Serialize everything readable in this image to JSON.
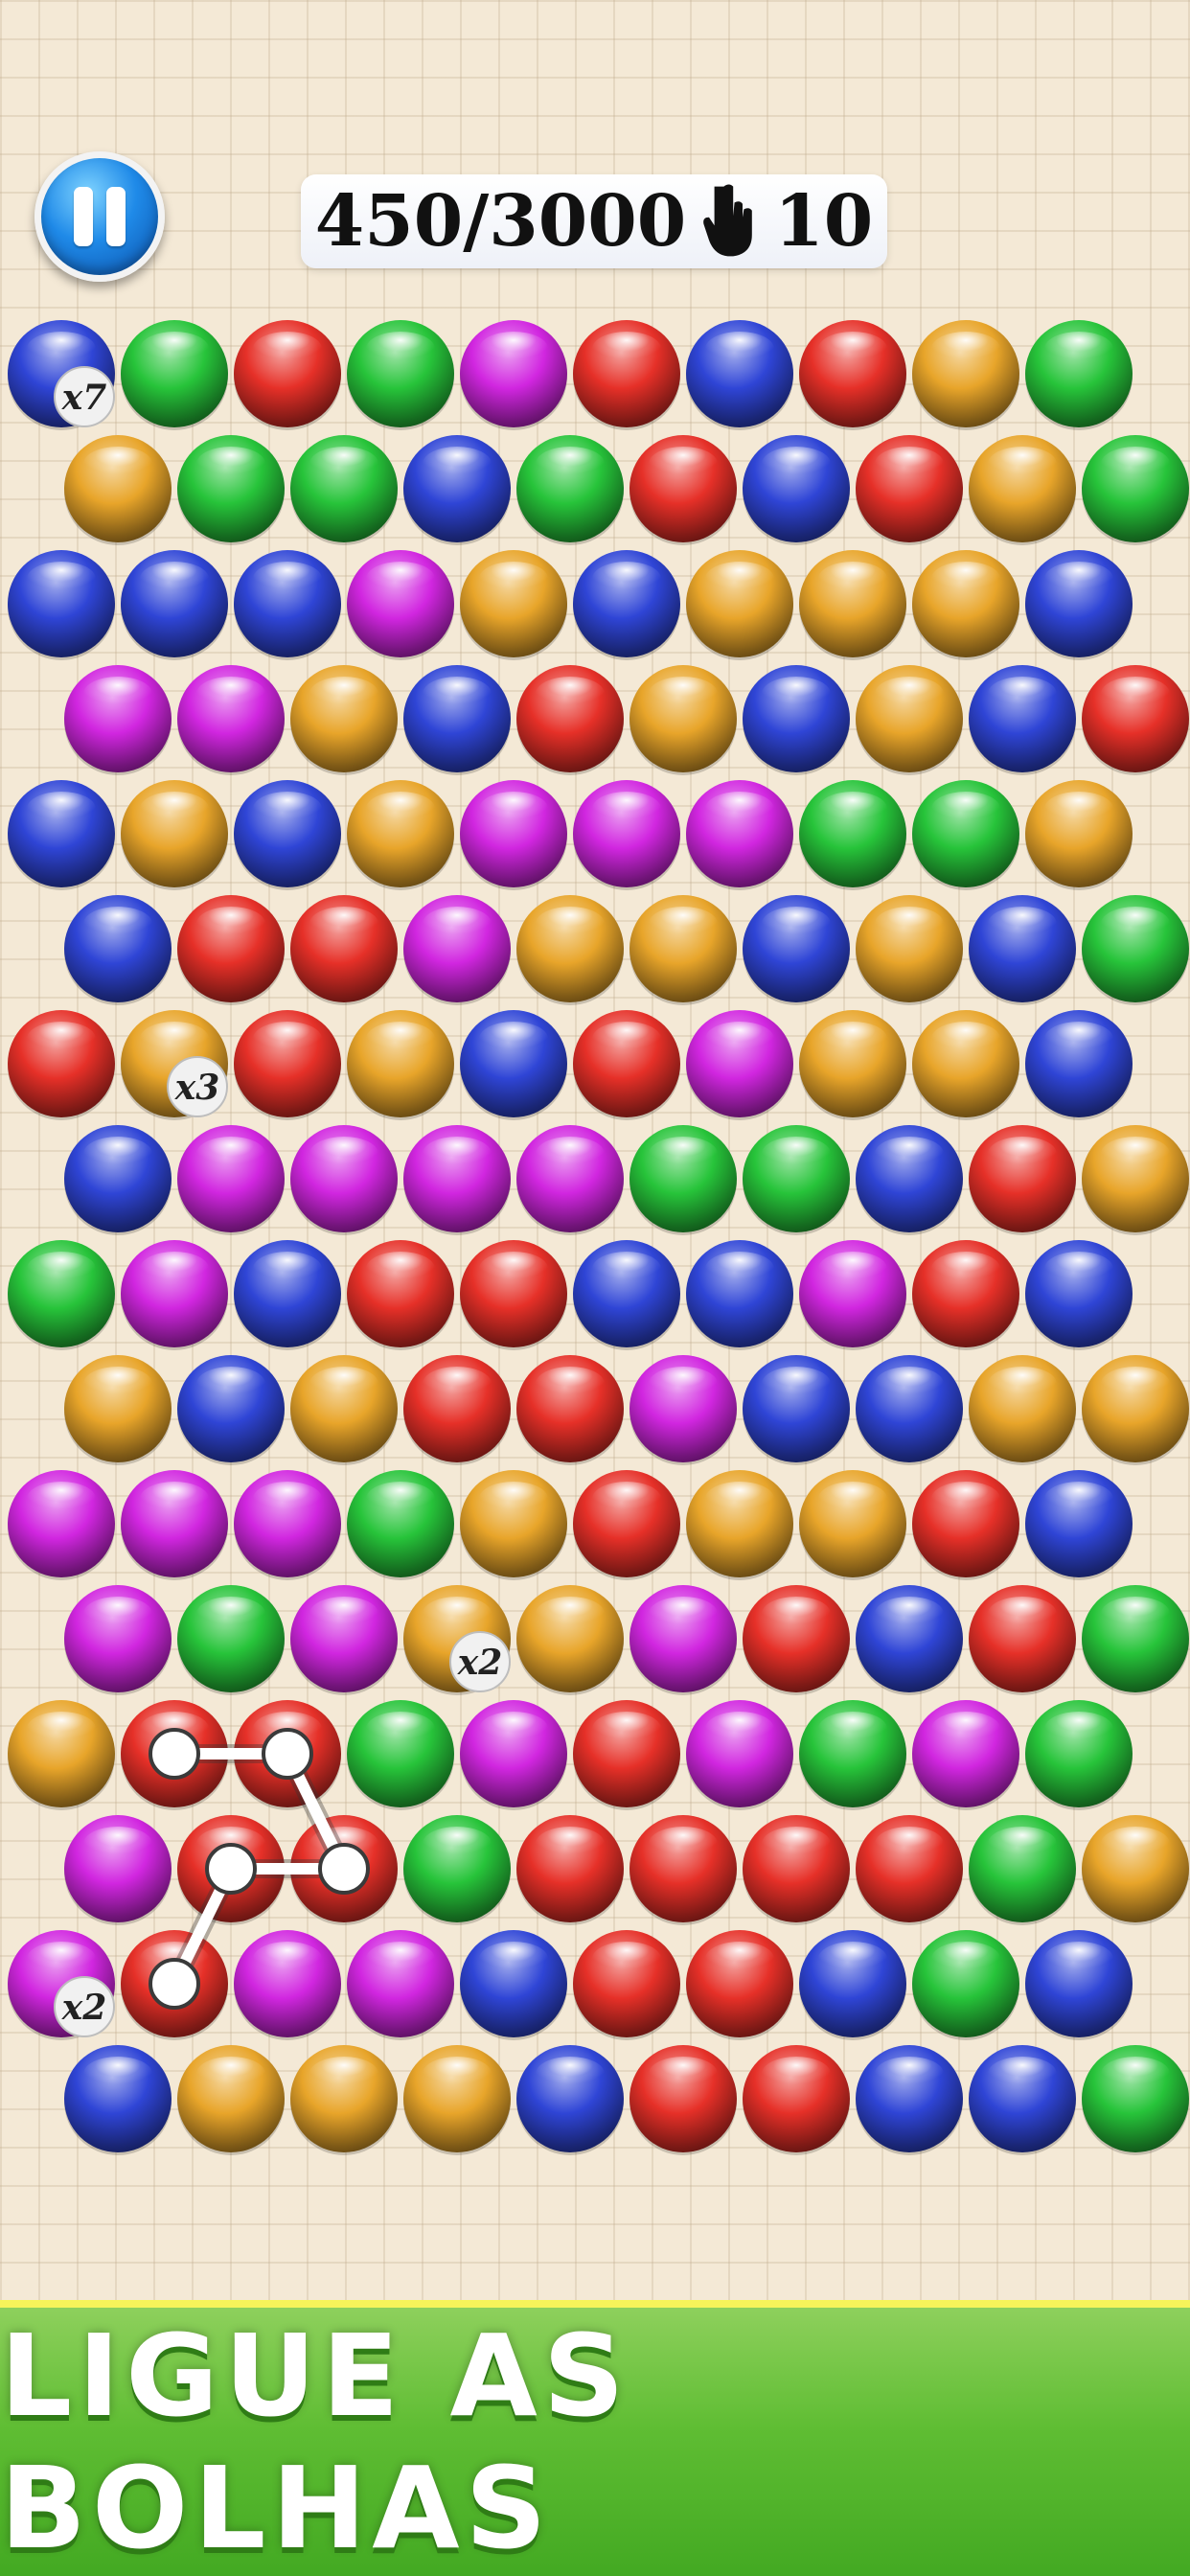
{
  "hud": {
    "score": "450/3000",
    "moves": "10",
    "icons": {
      "pause": "pause-icon",
      "moves": "hand-icon"
    }
  },
  "board": {
    "colors": {
      "blue": "#2f45d6",
      "green": "#27c43a",
      "red": "#e63028",
      "magenta": "#d126e0",
      "orange": "#e8a52a"
    },
    "rows": [
      [
        "blue",
        "green",
        "red",
        "green",
        "magenta",
        "red",
        "blue",
        "red",
        "orange",
        "green"
      ],
      [
        "orange",
        "green",
        "green",
        "blue",
        "green",
        "red",
        "blue",
        "red",
        "orange",
        "green"
      ],
      [
        "blue",
        "blue",
        "blue",
        "magenta",
        "orange",
        "blue",
        "orange",
        "orange",
        "orange",
        "blue"
      ],
      [
        "magenta",
        "magenta",
        "orange",
        "blue",
        "red",
        "orange",
        "blue",
        "orange",
        "blue",
        "red"
      ],
      [
        "blue",
        "orange",
        "blue",
        "orange",
        "magenta",
        "magenta",
        "magenta",
        "green",
        "green",
        "orange"
      ],
      [
        "blue",
        "red",
        "red",
        "magenta",
        "orange",
        "orange",
        "blue",
        "orange",
        "blue",
        "green"
      ],
      [
        "red",
        "orange",
        "red",
        "orange",
        "blue",
        "red",
        "magenta",
        "orange",
        "orange",
        "blue"
      ],
      [
        "blue",
        "magenta",
        "magenta",
        "magenta",
        "magenta",
        "green",
        "green",
        "blue",
        "red",
        "orange"
      ],
      [
        "green",
        "magenta",
        "blue",
        "red",
        "red",
        "blue",
        "blue",
        "magenta",
        "red",
        "blue"
      ],
      [
        "orange",
        "blue",
        "orange",
        "red",
        "red",
        "magenta",
        "blue",
        "blue",
        "orange",
        "orange"
      ],
      [
        "magenta",
        "magenta",
        "magenta",
        "green",
        "orange",
        "red",
        "orange",
        "orange",
        "red",
        "blue"
      ],
      [
        "magenta",
        "green",
        "magenta",
        "orange",
        "orange",
        "magenta",
        "red",
        "blue",
        "red",
        "green"
      ],
      [
        "orange",
        "red",
        "red",
        "green",
        "magenta",
        "red",
        "magenta",
        "green",
        "magenta",
        "green"
      ],
      [
        "magenta",
        "red",
        "red",
        "green",
        "red",
        "red",
        "red",
        "red",
        "green",
        "orange"
      ],
      [
        "magenta",
        "red",
        "magenta",
        "magenta",
        "blue",
        "red",
        "red",
        "blue",
        "green",
        "blue"
      ],
      [
        "blue",
        "orange",
        "orange",
        "orange",
        "blue",
        "red",
        "red",
        "blue",
        "blue",
        "green"
      ]
    ],
    "multipliers": [
      {
        "row": 0,
        "col": 0,
        "label": "x7"
      },
      {
        "row": 6,
        "col": 1,
        "label": "x3"
      },
      {
        "row": 11,
        "col": 3,
        "label": "x2"
      },
      {
        "row": 14,
        "col": 0,
        "label": "x2"
      }
    ],
    "connection_path": [
      {
        "row": 12,
        "col": 1
      },
      {
        "row": 12,
        "col": 2
      },
      {
        "row": 13,
        "col": 2
      },
      {
        "row": 13,
        "col": 1
      },
      {
        "row": 14,
        "col": 1
      }
    ]
  },
  "footer": {
    "text": "LIGUE AS BOLHAS"
  }
}
